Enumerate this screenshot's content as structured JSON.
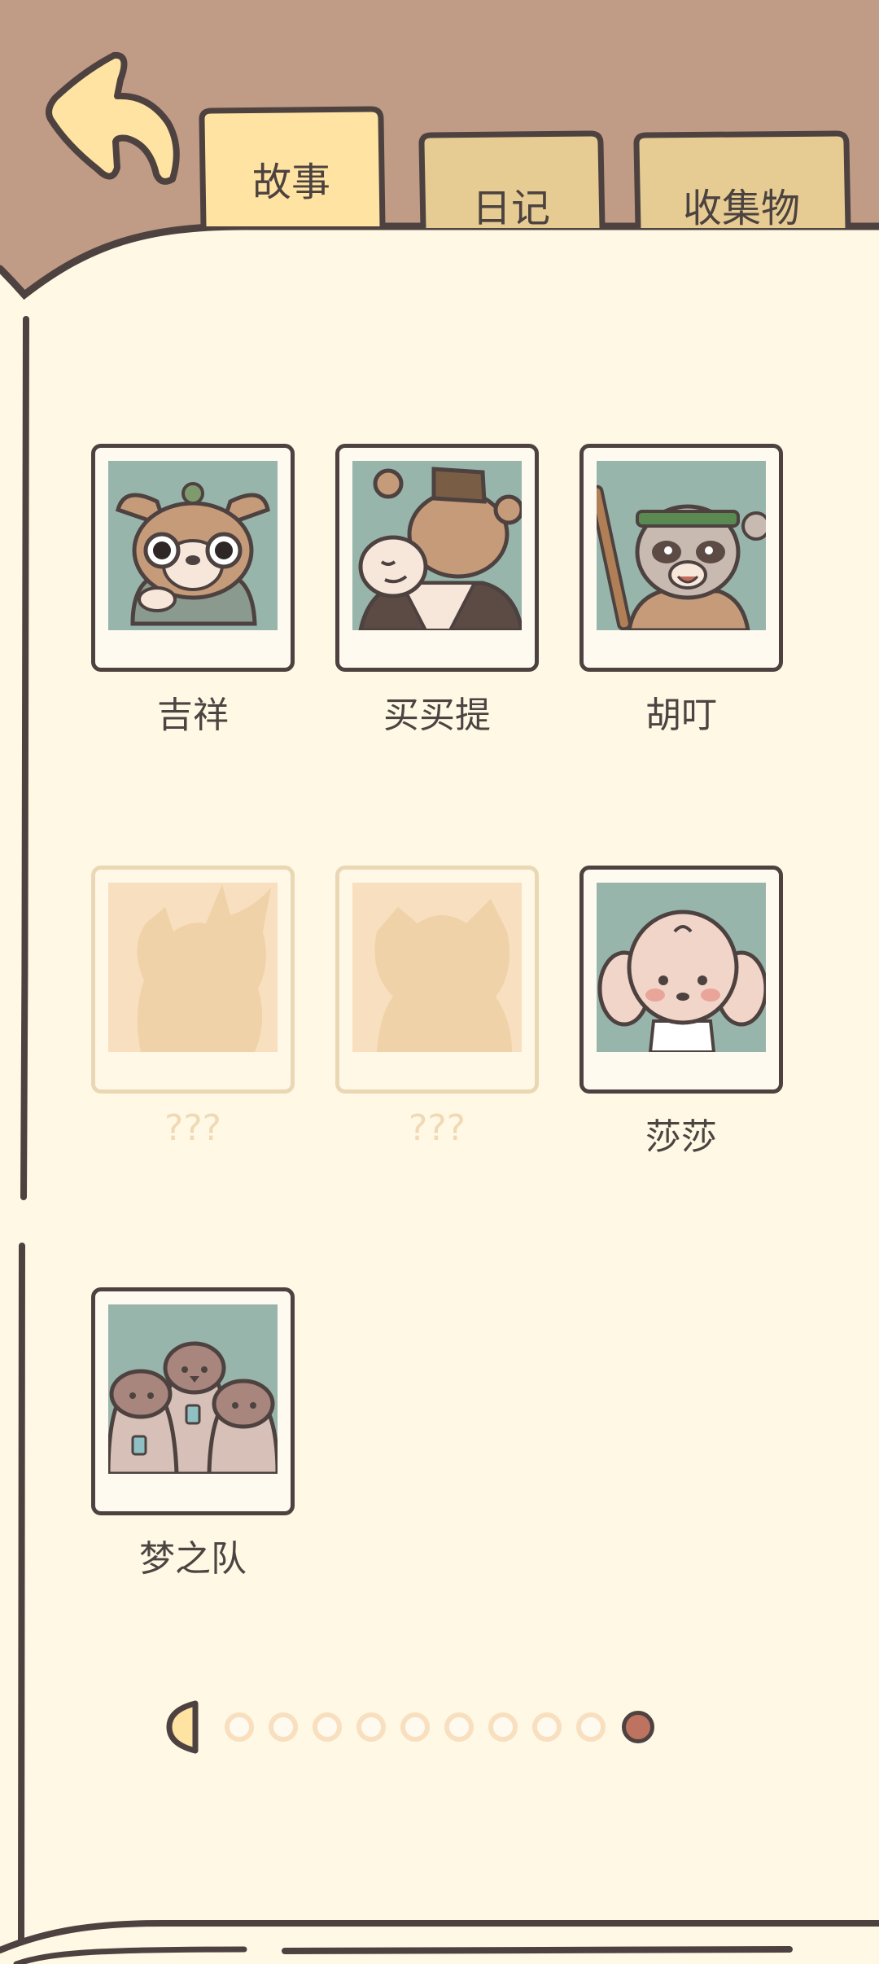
{
  "header": {
    "back_icon": "curved-back-arrow-icon",
    "tabs": [
      {
        "label": "故事",
        "active": true
      },
      {
        "label": "日记",
        "active": false
      },
      {
        "label": "收集物",
        "active": false
      }
    ]
  },
  "characters": [
    {
      "name": "吉祥",
      "unlocked": true,
      "portrait": "chihuahua-portrait"
    },
    {
      "name": "买买提",
      "unlocked": true,
      "portrait": "camel-portrait"
    },
    {
      "name": "胡叮",
      "unlocked": true,
      "portrait": "raccoon-portrait"
    },
    {
      "name": "???",
      "unlocked": false,
      "portrait": "silhouette-portrait"
    },
    {
      "name": "???",
      "unlocked": false,
      "portrait": "silhouette-portrait"
    },
    {
      "name": "莎莎",
      "unlocked": true,
      "portrait": "poodle-portrait"
    },
    {
      "name": "梦之队",
      "unlocked": true,
      "portrait": "penguins-portrait"
    }
  ],
  "pagination": {
    "prev_icon": "half-moon-prev-icon",
    "total_pages": 10,
    "current_page": 10
  },
  "colors": {
    "background": "#c09b86",
    "paper": "#fef8e4",
    "outline": "#4d4240",
    "active_tab": "#ffe3a3",
    "inactive_tab": "#e6cc93",
    "portrait_bg": "#98b5ac",
    "locked": "#f8dfbf",
    "active_dot": "#bd7360"
  }
}
